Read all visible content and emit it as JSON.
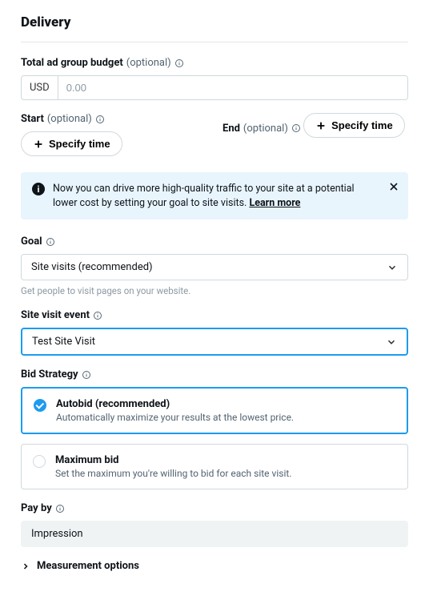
{
  "title": "Delivery",
  "budget": {
    "label": "Total ad group budget",
    "optional": "(optional)",
    "currency": "USD",
    "placeholder": "0.00"
  },
  "start": {
    "label": "Start",
    "optional": "(optional)",
    "button": "Specify time"
  },
  "end": {
    "label": "End",
    "optional": "(optional)",
    "button": "Specify time"
  },
  "banner": {
    "text": "Now you can drive more high-quality traffic to your site at a potential lower cost by setting your goal to site visits.",
    "learn": "Learn more"
  },
  "goal": {
    "label": "Goal",
    "value": "Site visits (recommended)",
    "helper": "Get people to visit pages on your website."
  },
  "siteVisitEvent": {
    "label": "Site visit event",
    "value": "Test Site Visit"
  },
  "bidStrategy": {
    "label": "Bid Strategy",
    "options": [
      {
        "title": "Autobid (recommended)",
        "sub": "Automatically maximize your results at the lowest price."
      },
      {
        "title": "Maximum bid",
        "sub": "Set the maximum you're willing to bid for each site visit."
      }
    ]
  },
  "payBy": {
    "label": "Pay by",
    "value": "Impression"
  },
  "measurement": {
    "label": "Measurement options"
  }
}
